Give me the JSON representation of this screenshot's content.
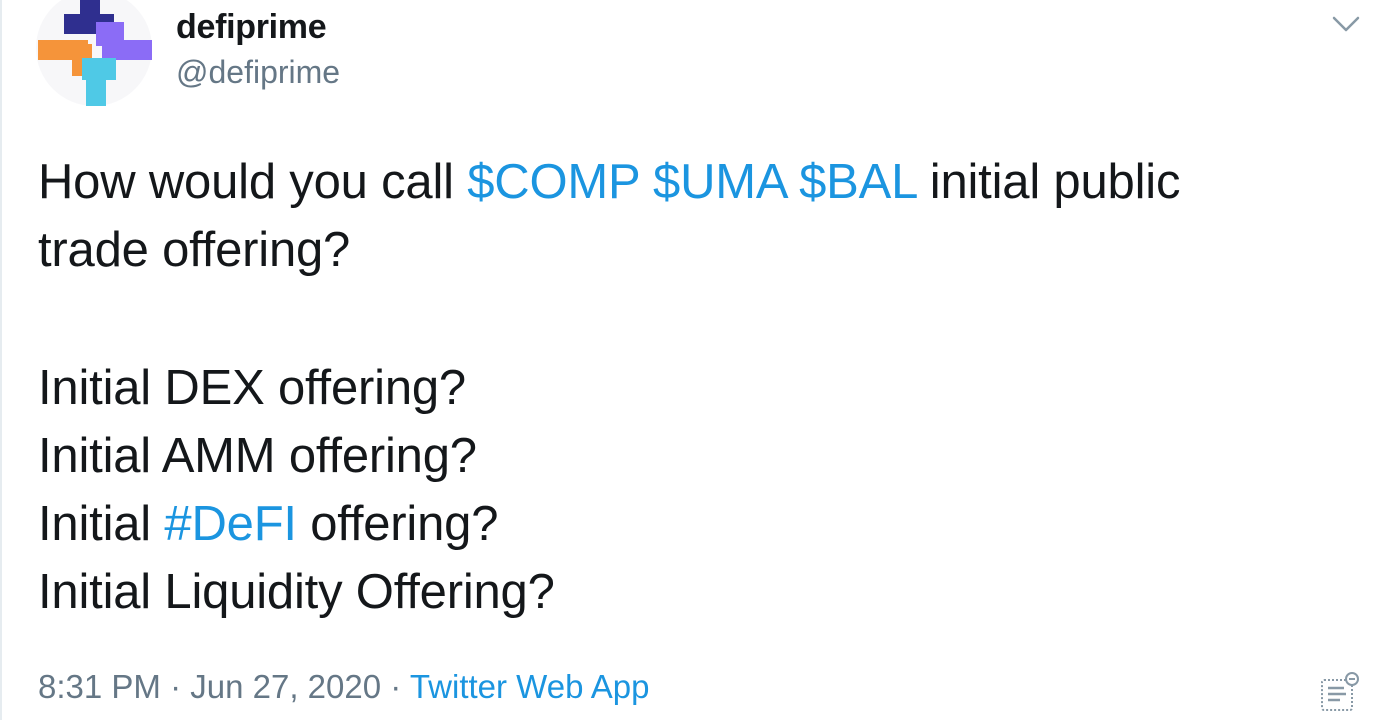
{
  "user": {
    "display_name": "defiprime",
    "handle": "@defiprime"
  },
  "icons": {
    "avatar": "defiprime-logo",
    "menu": "chevron-down-icon",
    "analytics": "analytics-icon"
  },
  "tweet": {
    "line1_prefix": "How would you call ",
    "cashtag_comp": "$COMP",
    "cashtag_uma": "$UMA",
    "cashtag_bal": "$BAL",
    "line1_suffix": " initial public",
    "line2": "trade offering?",
    "line3": "Initial DEX offering?",
    "line4": "Initial AMM offering?",
    "line5_prefix": "Initial ",
    "hashtag_defi": "#DeFI",
    "line5_suffix": " offering?",
    "line6": "Initial Liquidity Offering?"
  },
  "meta": {
    "time": "8:31 PM",
    "sep1": " · ",
    "date": "Jun 27, 2020",
    "sep2": " · ",
    "source": "Twitter Web App"
  },
  "colors": {
    "link": "#1b95e0",
    "secondary_text": "#657786",
    "logo_navy": "#2f2f8f",
    "logo_purple": "#8b6cf6",
    "logo_orange": "#f5943a",
    "logo_cyan": "#4fc9e6"
  }
}
